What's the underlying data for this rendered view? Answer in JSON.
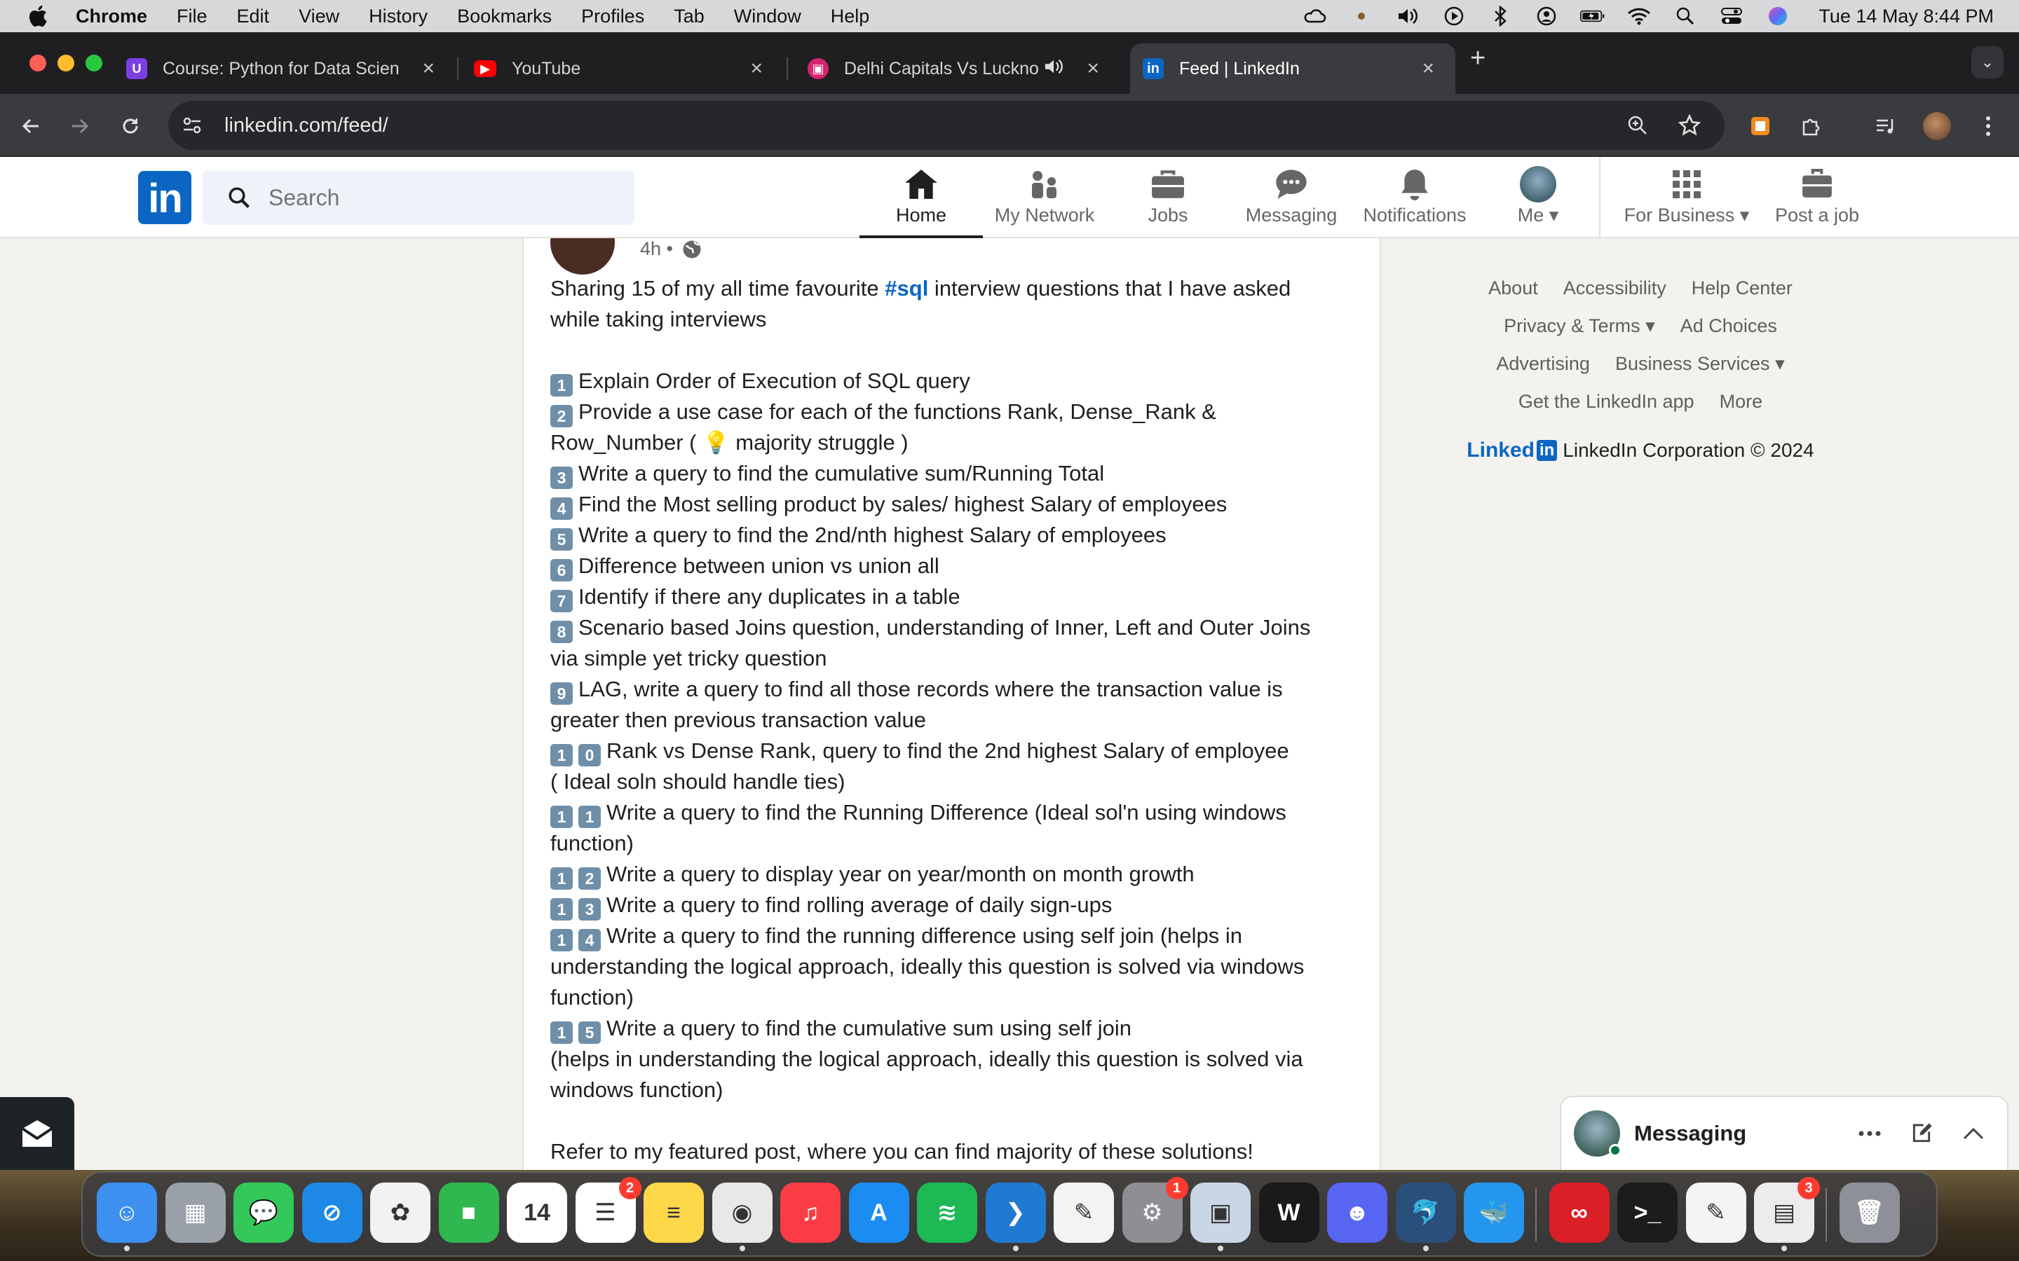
{
  "menubar": {
    "app_name": "Chrome",
    "menus": [
      "File",
      "Edit",
      "View",
      "History",
      "Bookmarks",
      "Profiles",
      "Tab",
      "Window",
      "Help"
    ],
    "clock": "Tue 14 May  8:44 PM"
  },
  "tabs": [
    {
      "title": "Course: Python for Data Scien",
      "icon": "course-icon",
      "color": "#7b3fe4"
    },
    {
      "title": "YouTube",
      "icon": "youtube-icon",
      "color": "#ff0000"
    },
    {
      "title": "Delhi Capitals Vs Luckno",
      "icon": "streaming-icon",
      "color": "#d6246e"
    },
    {
      "title": "Feed | LinkedIn",
      "icon": "linkedin-icon",
      "color": "#0a66c2"
    }
  ],
  "toolbar": {
    "url": "linkedin.com/feed/"
  },
  "linkedin": {
    "logo": "in",
    "search_placeholder": "Search",
    "nav": [
      {
        "label": "Home",
        "icon": "home-icon"
      },
      {
        "label": "My Network",
        "icon": "network-icon"
      },
      {
        "label": "Jobs",
        "icon": "briefcase-icon"
      },
      {
        "label": "Messaging",
        "icon": "chat-icon"
      },
      {
        "label": "Notifications",
        "icon": "bell-icon"
      },
      {
        "label": "Me",
        "icon": "avatar"
      },
      {
        "label": "For Business",
        "icon": "grid-icon"
      },
      {
        "label": "Post a job",
        "icon": "post-job-icon"
      }
    ],
    "accent": "#0a66c2"
  },
  "post": {
    "time": "4h •",
    "intro_before": "Sharing 15 of my all time favourite ",
    "hashtag": "#sql",
    "intro_after": " interview questions that I have asked",
    "intro_line2": "while taking interviews",
    "items": [
      {
        "num": [
          "1"
        ],
        "lines": [
          "Explain Order of Execution of SQL query"
        ]
      },
      {
        "num": [
          "2"
        ],
        "lines": [
          "Provide a use case for each of the functions Rank, Dense_Rank &",
          "Row_Number ( 💡 majority struggle )"
        ]
      },
      {
        "num": [
          "3"
        ],
        "lines": [
          "Write a query to find the cumulative sum/Running Total"
        ]
      },
      {
        "num": [
          "4"
        ],
        "lines": [
          "Find the Most selling product by sales/ highest Salary of employees"
        ]
      },
      {
        "num": [
          "5"
        ],
        "lines": [
          "Write a query to find the 2nd/nth highest Salary of employees"
        ]
      },
      {
        "num": [
          "6"
        ],
        "lines": [
          "Difference between union vs union all"
        ]
      },
      {
        "num": [
          "7"
        ],
        "lines": [
          "Identify if there any duplicates in a table"
        ]
      },
      {
        "num": [
          "8"
        ],
        "lines": [
          "Scenario based Joins question, understanding of Inner, Left and Outer Joins",
          "via simple yet tricky question"
        ]
      },
      {
        "num": [
          "9"
        ],
        "lines": [
          "LAG, write a query to find all those records where the transaction value is",
          "greater then previous transaction value"
        ]
      },
      {
        "num": [
          "1",
          "0"
        ],
        "lines": [
          "Rank vs Dense Rank, query to find the 2nd highest Salary of employee",
          "( Ideal soln should handle ties)"
        ]
      },
      {
        "num": [
          "1",
          "1"
        ],
        "lines": [
          "Write a query to find the Running Difference (Ideal sol'n using windows",
          "function)"
        ]
      },
      {
        "num": [
          "1",
          "2"
        ],
        "lines": [
          "Write a query to display year on year/month on month growth"
        ]
      },
      {
        "num": [
          "1",
          "3"
        ],
        "lines": [
          "Write a query to find rolling average of daily sign-ups"
        ]
      },
      {
        "num": [
          "1",
          "4"
        ],
        "lines": [
          "Write a query to find the running difference using self join (helps in",
          "understanding the logical approach, ideally this question is solved via windows",
          "function)"
        ]
      },
      {
        "num": [
          "1",
          "5"
        ],
        "lines": [
          "Write a query to find the cumulative sum using self join",
          "(helps in understanding the logical approach, ideally this question is solved via",
          "windows function)"
        ]
      }
    ],
    "outro": "Refer to my featured post, where you can find majority of these solutions!"
  },
  "footer": {
    "row1": [
      "About",
      "Accessibility",
      "Help Center"
    ],
    "row2": [
      "Privacy & Terms",
      "Ad Choices"
    ],
    "row3": [
      "Advertising",
      "Business Services"
    ],
    "row4": [
      "Get the LinkedIn app",
      "More"
    ],
    "wordmark": "Linked",
    "wordmark_in": "in",
    "corp": "LinkedIn Corporation © 2024"
  },
  "messaging": {
    "title": "Messaging"
  },
  "dock": {
    "apps": [
      {
        "name": "finder",
        "color": "#3d8ff0",
        "glyph": "☺"
      },
      {
        "name": "launchpad",
        "color": "#9aa0a8",
        "glyph": "▦"
      },
      {
        "name": "messages",
        "color": "#34c759",
        "glyph": "💬"
      },
      {
        "name": "safari",
        "color": "#1e88e5",
        "glyph": "⊘"
      },
      {
        "name": "photos",
        "color": "#f2f2f2",
        "glyph": "✿"
      },
      {
        "name": "facetime",
        "color": "#2fb84f",
        "glyph": "■"
      },
      {
        "name": "calendar",
        "color": "#ffffff",
        "glyph": "14"
      },
      {
        "name": "reminders",
        "color": "#ffffff",
        "glyph": "☰",
        "badge": "2"
      },
      {
        "name": "notes",
        "color": "#ffd84a",
        "glyph": "≡"
      },
      {
        "name": "chrome",
        "color": "#e8e8e8",
        "glyph": "◉"
      },
      {
        "name": "music",
        "color": "#fc3c44",
        "glyph": "♫"
      },
      {
        "name": "app-store",
        "color": "#1b8cf2",
        "glyph": "A"
      },
      {
        "name": "spotify",
        "color": "#1db954",
        "glyph": "≋"
      },
      {
        "name": "vscode",
        "color": "#1f7ad1",
        "glyph": "❯"
      },
      {
        "name": "pages",
        "color": "#f3f3f3",
        "glyph": "✎"
      },
      {
        "name": "system-settings",
        "color": "#8e8e93",
        "glyph": "⚙",
        "badge": "1"
      },
      {
        "name": "preview",
        "color": "#c9d6e6",
        "glyph": "▣"
      },
      {
        "name": "webex",
        "color": "#1a1a1a",
        "glyph": "W"
      },
      {
        "name": "discord",
        "color": "#5865f2",
        "glyph": "☻"
      },
      {
        "name": "mysql-workbench",
        "color": "#2a4f7a",
        "glyph": "🐬"
      },
      {
        "name": "docker",
        "color": "#2496ed",
        "glyph": "🐳"
      },
      {
        "name": "creative-cloud",
        "color": "#da1f26",
        "glyph": "∞"
      },
      {
        "name": "terminal",
        "color": "#1c1c1e",
        "glyph": ">_"
      },
      {
        "name": "textedit",
        "color": "#f4f4f4",
        "glyph": "✎"
      },
      {
        "name": "office-installer",
        "color": "#ececec",
        "glyph": "▤",
        "badge": "3"
      },
      {
        "name": "trash",
        "color": "#8d9096",
        "glyph": "🗑"
      }
    ]
  }
}
